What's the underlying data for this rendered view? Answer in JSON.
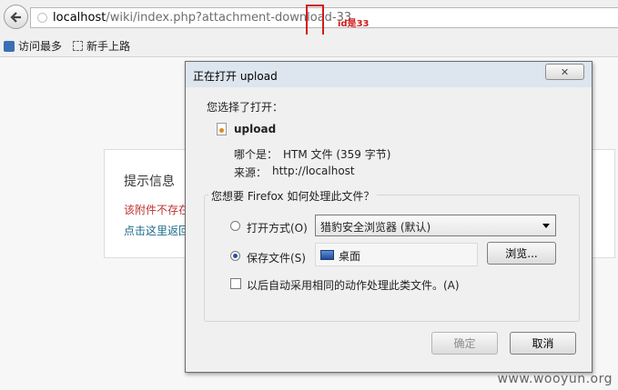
{
  "browser": {
    "url_host": "localhost",
    "url_path": "/wiki/index.php?attachment-download-",
    "url_id": "33",
    "annotation": "id是33"
  },
  "bookmarks": [
    {
      "label": "访问最多"
    },
    {
      "label": "新手上路"
    }
  ],
  "page": {
    "title": "提示信息",
    "error": "该附件不存在",
    "link": "点击这里返回"
  },
  "dialog": {
    "title": "正在打开 upload",
    "close": "✕",
    "selected_label": "您选择了打开：",
    "file_name": "upload",
    "type_label": "哪个是：",
    "type_value": "HTM 文件 (359 字节)",
    "source_label": "来源：",
    "source_value": "http://localhost",
    "group_title": "您想要 Firefox 如何处理此文件？",
    "open_with_label": "打开方式(O)",
    "open_with_value": "猎豹安全浏览器 (默认)",
    "save_label": "保存文件(S)",
    "save_location": "桌面",
    "browse_label": "浏览...",
    "auto_label": "以后自动采用相同的动作处理此类文件。(A)",
    "ok_label": "确定",
    "cancel_label": "取消"
  },
  "watermark": "www.wooyun.org"
}
